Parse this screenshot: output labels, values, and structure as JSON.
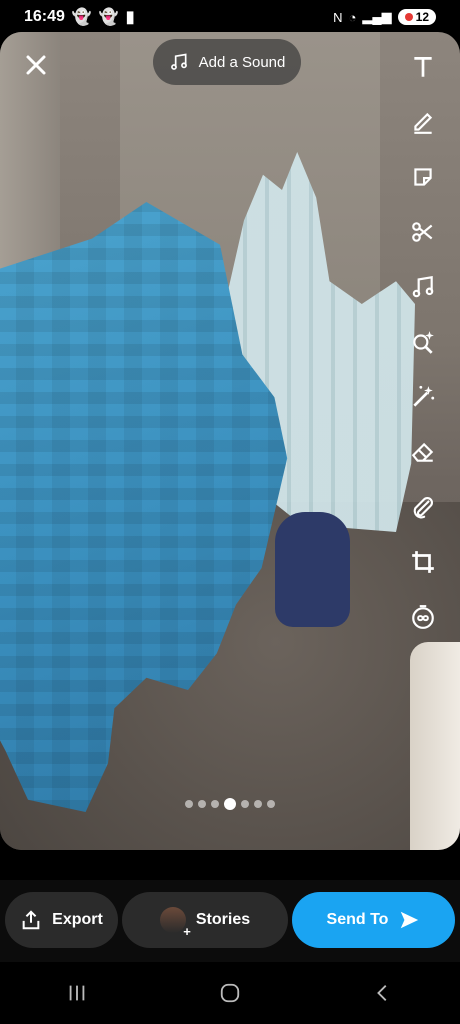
{
  "status_bar": {
    "time": "16:49",
    "battery": "12",
    "icons": [
      "snapchat-icon",
      "snapchat-icon",
      "battery-icon",
      "nfc-icon",
      "wifi-icon",
      "signal-icon"
    ]
  },
  "editor": {
    "add_sound_label": "Add a Sound",
    "tools": [
      "text-tool-icon",
      "pen-tool-icon",
      "sticker-tool-icon",
      "scissors-tool-icon",
      "music-tool-icon",
      "lens-search-tool-icon",
      "magic-wand-tool-icon",
      "eraser-tool-icon",
      "paperclip-tool-icon",
      "crop-tool-icon",
      "timer-tool-icon"
    ],
    "pagination": {
      "total": 7,
      "active": 3
    }
  },
  "actions": {
    "export_label": "Export",
    "stories_label": "Stories",
    "send_label": "Send To"
  },
  "colors": {
    "send_button": "#1aa4f2",
    "button_dark": "#2b2b2b"
  }
}
